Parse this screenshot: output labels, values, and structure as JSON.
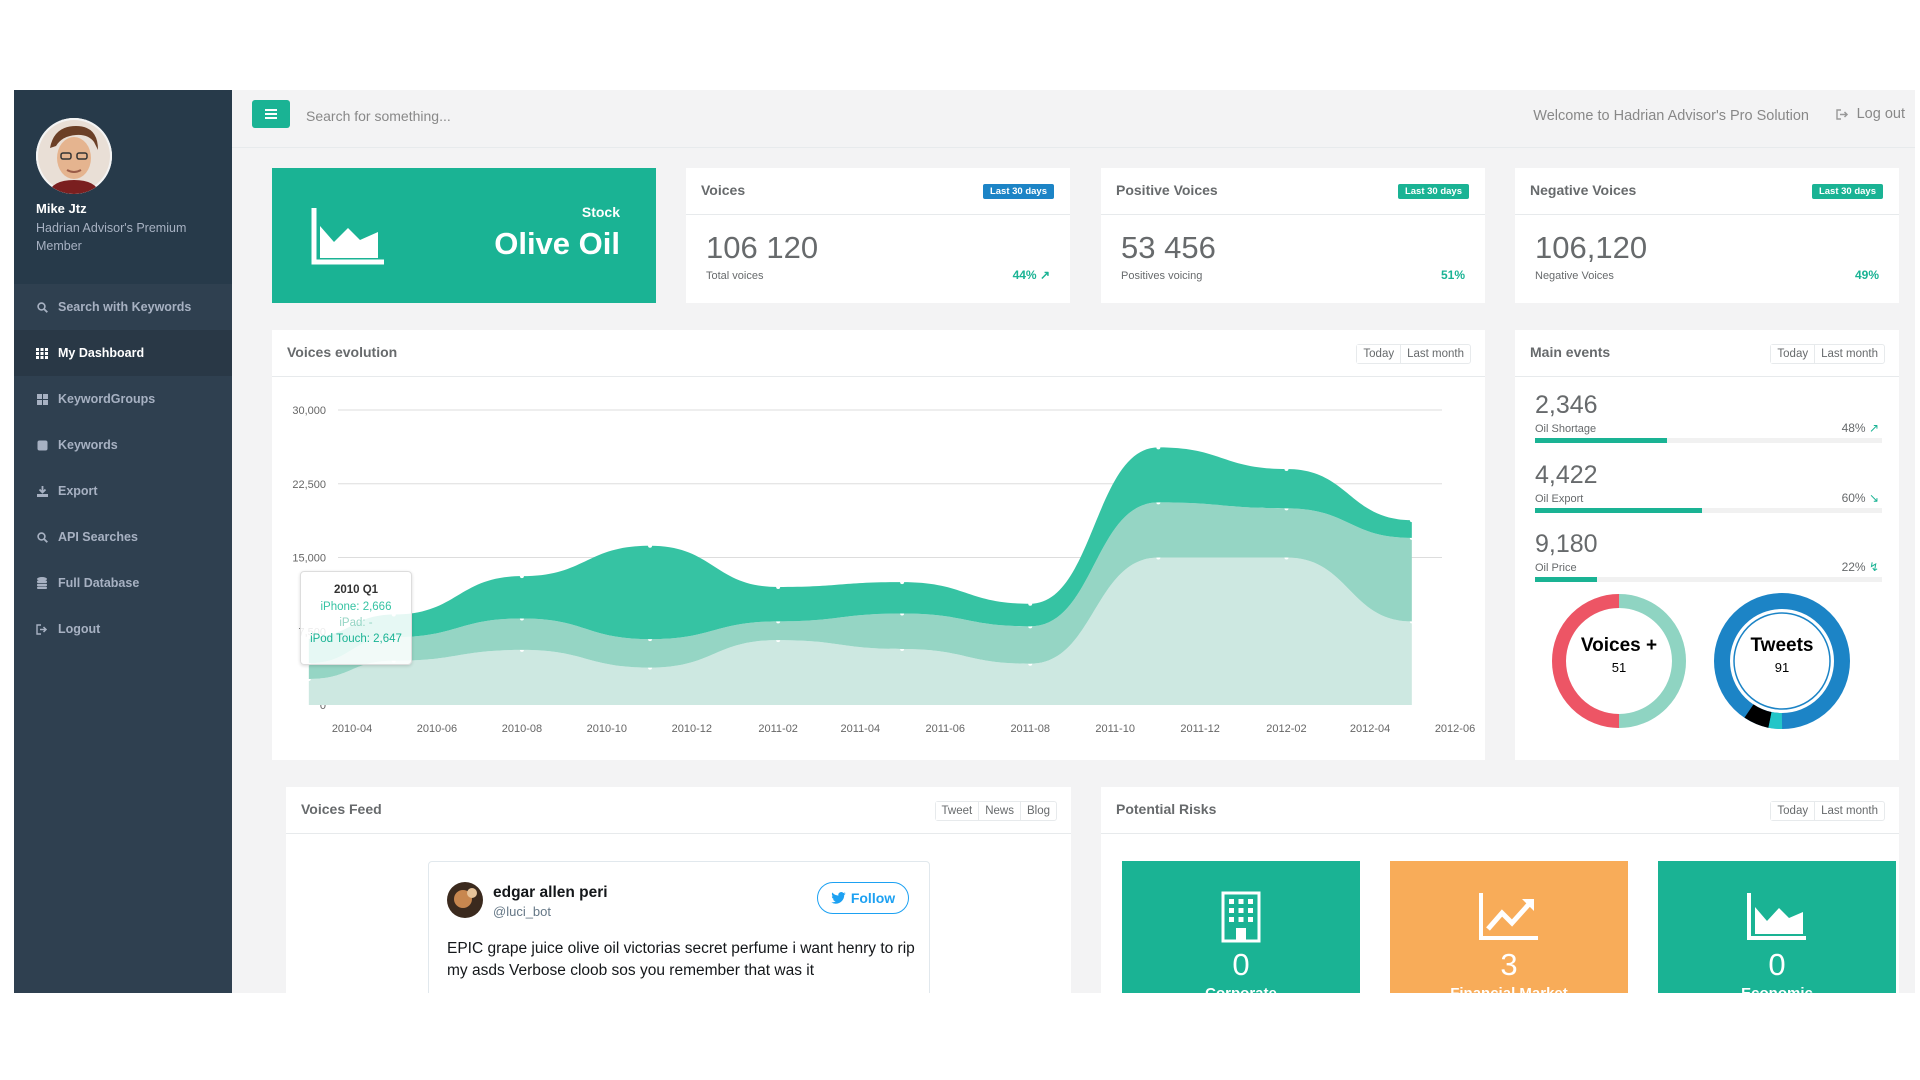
{
  "user": {
    "name": "Mike Jtz",
    "role": "Hadrian Advisor's Premium Member"
  },
  "sidebar": {
    "items": [
      {
        "label": "Search with Keywords",
        "icon": "search-icon"
      },
      {
        "label": "My Dashboard",
        "icon": "grid-icon",
        "active": true
      },
      {
        "label": "KeywordGroups",
        "icon": "tiles-icon"
      },
      {
        "label": "Keywords",
        "icon": "square-icon"
      },
      {
        "label": "Export",
        "icon": "download-icon"
      },
      {
        "label": "API Searches",
        "icon": "search-icon"
      },
      {
        "label": "Full Database",
        "icon": "database-icon"
      },
      {
        "label": "Logout",
        "icon": "sign-out-icon"
      }
    ]
  },
  "topbar": {
    "search_placeholder": "Search for something...",
    "welcome": "Welcome to Hadrian Advisor's Pro Solution",
    "logout": "Log out"
  },
  "stock_tile": {
    "stock_label": "Stock",
    "name": "Olive Oil"
  },
  "stats": [
    {
      "title": "Voices",
      "badge": "Last 30 days",
      "value": "106 120",
      "sub": "Total voices",
      "pct": "44%"
    },
    {
      "title": "Positive Voices",
      "badge": "Last 30 days",
      "value": "53 456",
      "sub": "Positives voicing",
      "pct": "51%"
    },
    {
      "title": "Negative Voices",
      "badge": "Last 30 days",
      "value": "106,120",
      "sub": "Negative Voices",
      "pct": "49%"
    }
  ],
  "evolution": {
    "title": "Voices evolution",
    "buttons": [
      "Today",
      "Last month"
    ],
    "tooltip": {
      "title": "2010 Q1",
      "lines": [
        "iPhone: 2,666",
        "iPad: -",
        "iPod Touch: 2,647"
      ]
    }
  },
  "chart_data": {
    "type": "area",
    "title": "Voices evolution",
    "xlabel": "",
    "ylabel": "",
    "x": [
      "2010-03",
      "2010-05",
      "2010-08",
      "2010-11",
      "2011-02",
      "2011-05",
      "2011-08",
      "2011-11",
      "2012-02",
      "2012-05"
    ],
    "x_ticks": [
      "2010-04",
      "2010-06",
      "2010-08",
      "2010-10",
      "2010-12",
      "2011-02",
      "2011-04",
      "2011-06",
      "2011-08",
      "2011-10",
      "2011-12",
      "2012-02",
      "2012-04",
      "2012-06"
    ],
    "y_ticks": [
      "0",
      "7,500",
      "15,000",
      "22,500",
      "30,000"
    ],
    "ylim": [
      0,
      30000
    ],
    "stacked": true,
    "series": [
      {
        "name": "iPod Touch",
        "color": "#cde8e1",
        "values": [
          2647,
          4500,
          5600,
          3800,
          6600,
          5700,
          4200,
          15000,
          15000,
          8500
        ]
      },
      {
        "name": "iPad",
        "color": "#95d5c4",
        "values": [
          1600,
          2400,
          3200,
          2900,
          1900,
          3600,
          3800,
          5600,
          5000,
          8500
        ]
      },
      {
        "name": "iPhone",
        "color": "#36c3a3",
        "values": [
          2666,
          2300,
          4300,
          9500,
          3500,
          3200,
          2300,
          5600,
          4000,
          1800
        ]
      }
    ],
    "grid": true,
    "legend": "none"
  },
  "events": {
    "title": "Main events",
    "buttons": [
      "Today",
      "Last month"
    ],
    "items": [
      {
        "value": "2,346",
        "label": "Oil Shortage",
        "pct": "48%",
        "fill": 0.38
      },
      {
        "value": "4,422",
        "label": "Oil Export",
        "pct": "60%",
        "fill": 0.48
      },
      {
        "value": "9,180",
        "label": "Oil Price",
        "pct": "22%",
        "fill": 0.18
      }
    ],
    "donuts": [
      {
        "label": "Voices +",
        "value": "51"
      },
      {
        "label": "Tweets",
        "value": "91"
      }
    ]
  },
  "feed": {
    "title": "Voices Feed",
    "buttons": [
      "Tweet",
      "News",
      "Blog"
    ],
    "tweet": {
      "name": "edgar allen peri",
      "handle": "@luci_bot",
      "follow": "Follow",
      "text": "EPIC grape juice olive oil victorias secret perfume i want henry to rip my asds Verbose cloob sos you remember that was it"
    }
  },
  "risks": {
    "title": "Potential Risks",
    "buttons": [
      "Today",
      "Last month"
    ],
    "items": [
      {
        "value": "0",
        "label": "Corporate",
        "color": "#1ab394",
        "icon": "building-icon"
      },
      {
        "value": "3",
        "label": "Financial Market",
        "color": "#f8ac59",
        "icon": "trend-up-icon"
      },
      {
        "value": "0",
        "label": "Economic",
        "color": "#1ab394",
        "icon": "area-chart-icon"
      }
    ]
  }
}
